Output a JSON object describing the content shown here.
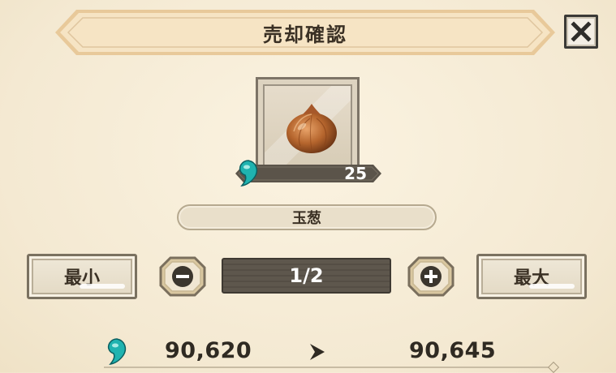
{
  "dialog": {
    "title": "売却確認",
    "close_icon": "close-x-icon"
  },
  "item": {
    "name": "玉葱",
    "icon": "onion-icon",
    "price_icon": "teal-gem-icon",
    "price": "25"
  },
  "quantity": {
    "min_label": "最小",
    "max_label": "最大",
    "decrement_icon": "minus-icon",
    "increment_icon": "plus-icon",
    "value": "1/2"
  },
  "currency": {
    "icon": "teal-gem-icon",
    "current": "90,620",
    "arrow_icon": "arrow-right-icon",
    "after": "90,645"
  },
  "colors": {
    "background": "#f4e9d2",
    "banner": "#f3dcb6",
    "frame": "#7d7467",
    "gem": "#1fb3b0"
  }
}
